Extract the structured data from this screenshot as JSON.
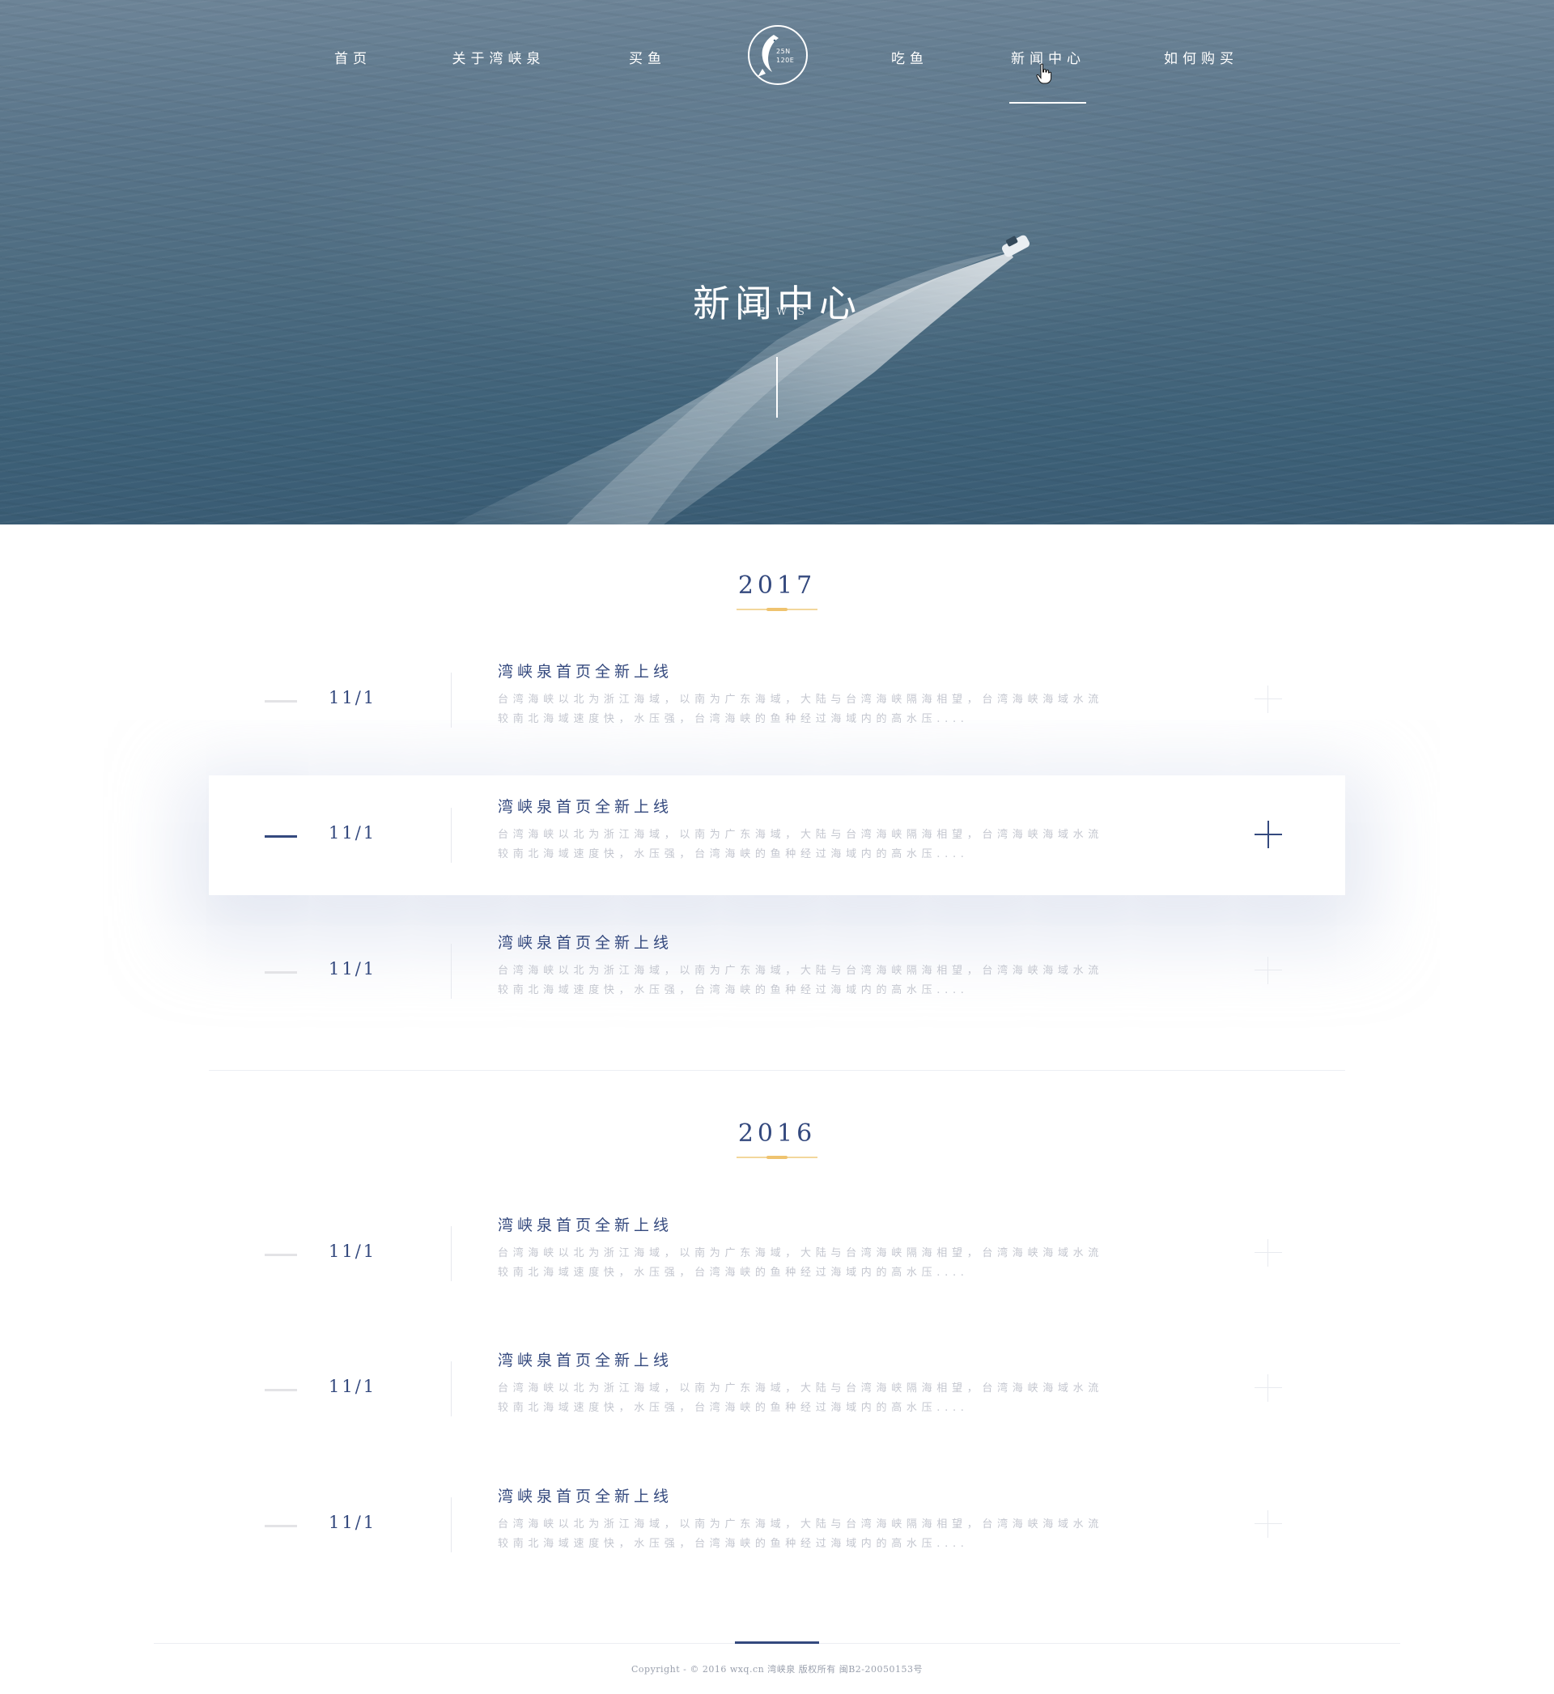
{
  "nav": {
    "items": [
      {
        "label": "首页"
      },
      {
        "label": "关于湾峡泉"
      },
      {
        "label": "买鱼"
      },
      {
        "label": "吃鱼"
      },
      {
        "label": "新闻中心"
      },
      {
        "label": "如何购买"
      }
    ],
    "active": "新闻中心",
    "logo": {
      "line1": "25N",
      "line2": "120E"
    }
  },
  "hero": {
    "title": "新闻中心",
    "subtitle": "NEWS"
  },
  "sections": [
    {
      "year": "2017",
      "items": [
        {
          "date": "11/1",
          "title": "湾峡泉首页全新上线",
          "summary": "台湾海峡以北为浙江海域，以南为广东海域，大陆与台湾海峡隔海相望，台湾海峡海域水流较南北海域速度快，水压强，台湾海峡的鱼种经过海域内的高水压....",
          "active": false
        },
        {
          "date": "11/1",
          "title": "湾峡泉首页全新上线",
          "summary": "台湾海峡以北为浙江海域，以南为广东海域，大陆与台湾海峡隔海相望，台湾海峡海域水流较南北海域速度快，水压强，台湾海峡的鱼种经过海域内的高水压....",
          "active": true
        },
        {
          "date": "11/1",
          "title": "湾峡泉首页全新上线",
          "summary": "台湾海峡以北为浙江海域，以南为广东海域，大陆与台湾海峡隔海相望，台湾海峡海域水流较南北海域速度快，水压强，台湾海峡的鱼种经过海域内的高水压....",
          "active": false
        }
      ]
    },
    {
      "year": "2016",
      "items": [
        {
          "date": "11/1",
          "title": "湾峡泉首页全新上线",
          "summary": "台湾海峡以北为浙江海域，以南为广东海域，大陆与台湾海峡隔海相望，台湾海峡海域水流较南北海域速度快，水压强，台湾海峡的鱼种经过海域内的高水压....",
          "active": false
        },
        {
          "date": "11/1",
          "title": "湾峡泉首页全新上线",
          "summary": "台湾海峡以北为浙江海域，以南为广东海域，大陆与台湾海峡隔海相望，台湾海峡海域水流较南北海域速度快，水压强，台湾海峡的鱼种经过海域内的高水压....",
          "active": false
        },
        {
          "date": "11/1",
          "title": "湾峡泉首页全新上线",
          "summary": "台湾海峡以北为浙江海域，以南为广东海域，大陆与台湾海峡隔海相望，台湾海峡海域水流较南北海域速度快，水压强，台湾海峡的鱼种经过海域内的高水压....",
          "active": false
        }
      ]
    }
  ],
  "footer": {
    "copyright": "Copyright - © 2016 wxq.cn 湾峡泉 版权所有 闽B2-20050153号"
  },
  "colors": {
    "accent": "#34497e",
    "gold": "#efc36f",
    "muted_text": "#c3c6cf"
  },
  "icons": {
    "expand": "plus-icon",
    "pointer": "hand-cursor-icon",
    "brand": "fish-logo-icon"
  }
}
